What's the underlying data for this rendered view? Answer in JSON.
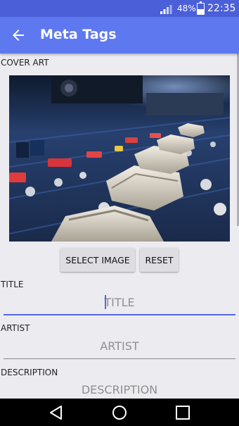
{
  "status_bar": {
    "battery_percent": "48%",
    "battery_level": 0.48,
    "time": "22:35",
    "signal_icon": "signal-icon",
    "battery_icon": "battery-icon"
  },
  "app_bar": {
    "title": "Meta Tags",
    "back_icon": "arrow-back-icon",
    "color": "#5e78f0"
  },
  "cover_art": {
    "label": "COVER ART",
    "image": "audio mixing console faders photo"
  },
  "buttons": {
    "select_image": "SELECT IMAGE",
    "reset": "RESET"
  },
  "fields": {
    "title": {
      "label": "TITLE",
      "placeholder": "TITLE",
      "value": ""
    },
    "artist": {
      "label": "ARTIST",
      "placeholder": "ARTIST",
      "value": ""
    },
    "description": {
      "label": "DESCRIPTION",
      "placeholder": "DESCRIPTION",
      "value": ""
    }
  },
  "nav_bar": {
    "back": "nav-back-icon",
    "home": "nav-home-icon",
    "recents": "nav-recents-icon"
  }
}
